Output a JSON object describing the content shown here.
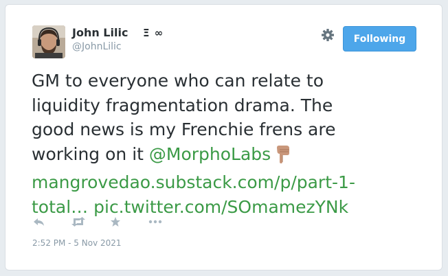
{
  "user": {
    "display_name": "John Lilic",
    "name_suffix": "Ξ ∞",
    "handle": "@JohnLilic"
  },
  "follow_button": {
    "label": "Following",
    "color": "#4da6ea"
  },
  "tweet": {
    "lines": [
      "GM to everyone who can relate to",
      "liquidity fragmentation drama. The",
      "good news is my Frenchie frens are",
      "working on it "
    ],
    "mention": "@MorphoLabs",
    "link_1": "mangrovedao.substack.com/p/part-1-",
    "link_2": "total…",
    "pic_link": "pic.twitter.com/SOmamezYNk",
    "link_color": "#3b9a46"
  },
  "actions": [
    {
      "icon": "reply-icon"
    },
    {
      "icon": "retweet-icon"
    },
    {
      "icon": "favorite-icon"
    },
    {
      "icon": "more-icon"
    }
  ],
  "timestamp": "2:52 PM - 5 Nov 2021"
}
